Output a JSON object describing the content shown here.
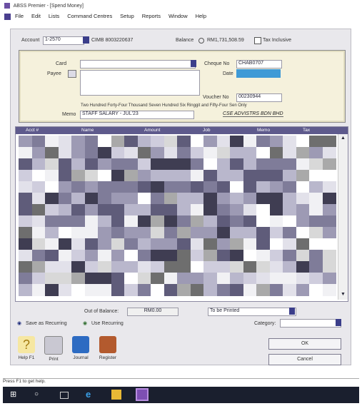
{
  "window": {
    "title": "ABSS Premier - [Spend Money]"
  },
  "menu": [
    "File",
    "Edit",
    "Lists",
    "Command Centres",
    "Setup",
    "Reports",
    "Window",
    "Help"
  ],
  "account": {
    "label": "Account",
    "code": "1-2570",
    "name": "CIMB 8003220637",
    "balance_label": "Balance",
    "balance_value": "RM1,731,508.59",
    "tax_inclusive_label": "Tax Inclusive"
  },
  "cheque": {
    "card_label": "Card",
    "payee_label": "Payee",
    "cheque_no_label": "Cheque No",
    "cheque_no_value": "CHAB0707",
    "date_label": "Date",
    "voucher_no_label": "Voucher No",
    "voucher_no_value": "00230944",
    "amount_words": "Two Hundred Forty-Four Thousand Seven Hundred Six Ringgit and Fifty-Four Sen Only",
    "memo_label": "Memo",
    "memo_value": "STAFF SALARY - JUL'23",
    "signature_text": "CSE ADVISTRS BDN BHD"
  },
  "table": {
    "columns": [
      "Acct #",
      "Name",
      "Amount",
      "Job",
      "Memo",
      "Tax"
    ]
  },
  "footer": {
    "out_of_balance_label": "Out of Balance:",
    "out_of_balance_value": "RM0.00",
    "delivery_value": "To be Printed",
    "save_recurring": "Save as Recurring",
    "use_recurring": "Use Recurring",
    "category_label": "Category:"
  },
  "toolbar": {
    "help": "Help F1",
    "print": "Print",
    "journal": "Journal",
    "register": "Register"
  },
  "buttons": {
    "ok": "OK",
    "cancel": "Cancel"
  },
  "status": {
    "text": "Press F1 to get help."
  },
  "colors": {
    "header": "#5e5a8c",
    "cheque_bg": "#f5f1dc",
    "taskbar": "#1a1f2e"
  }
}
